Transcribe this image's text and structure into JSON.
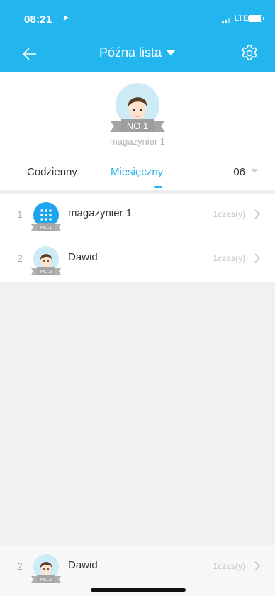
{
  "status_bar": {
    "time": "08:21",
    "network": "LTE"
  },
  "header": {
    "title": "Późna lista",
    "background_color": "#22b5ee"
  },
  "top_winner": {
    "badge": "NO.1",
    "name": "magazynier 1"
  },
  "tabs": {
    "daily": "Codzienny",
    "monthly": "Miesięczny",
    "active": "monthly"
  },
  "month_select": {
    "value": "06"
  },
  "ranking": [
    {
      "rank": "1",
      "name": "magazynier 1",
      "count": "1czas(y)",
      "badge": "NO.1"
    },
    {
      "rank": "2",
      "name": "Dawid",
      "count": "1czas(y)",
      "badge": "NO.2"
    }
  ],
  "sticky_row": {
    "rank": "2",
    "name": "Dawid",
    "count": "1czas(y)",
    "badge": "NO.2"
  },
  "icons": {
    "back": "back-arrow-icon",
    "settings": "gear-icon",
    "dropdown": "caret-down-icon",
    "row_arrow": "chevron-right-icon"
  }
}
